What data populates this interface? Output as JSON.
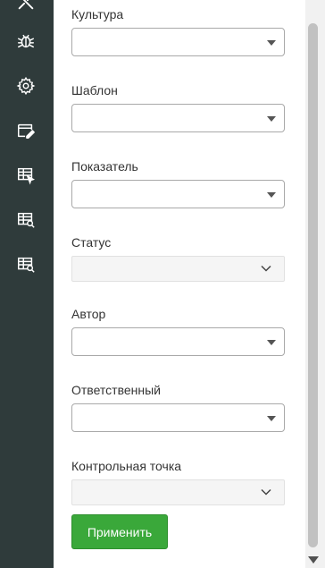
{
  "sidebar": {
    "icons": [
      {
        "name": "tools-icon"
      },
      {
        "name": "bug-icon"
      },
      {
        "name": "gear-icon"
      },
      {
        "name": "window-edit-icon"
      },
      {
        "name": "table-cursor-icon"
      },
      {
        "name": "table-search-icon"
      },
      {
        "name": "table-search-alt-icon"
      }
    ]
  },
  "filters": {
    "culture": {
      "label": "Культура",
      "value": ""
    },
    "template": {
      "label": "Шаблон",
      "value": ""
    },
    "indicator": {
      "label": "Показатель",
      "value": ""
    },
    "status": {
      "label": "Статус",
      "value": ""
    },
    "author": {
      "label": "Автор",
      "value": ""
    },
    "responsible": {
      "label": "Ответственный",
      "value": ""
    },
    "checkpoint": {
      "label": "Контрольная точка",
      "value": ""
    }
  },
  "actions": {
    "apply_label": "Применить"
  },
  "colors": {
    "sidebar_bg": "#2f3b3b",
    "icon": "#ffffff",
    "apply_bg": "#3aa83a"
  }
}
